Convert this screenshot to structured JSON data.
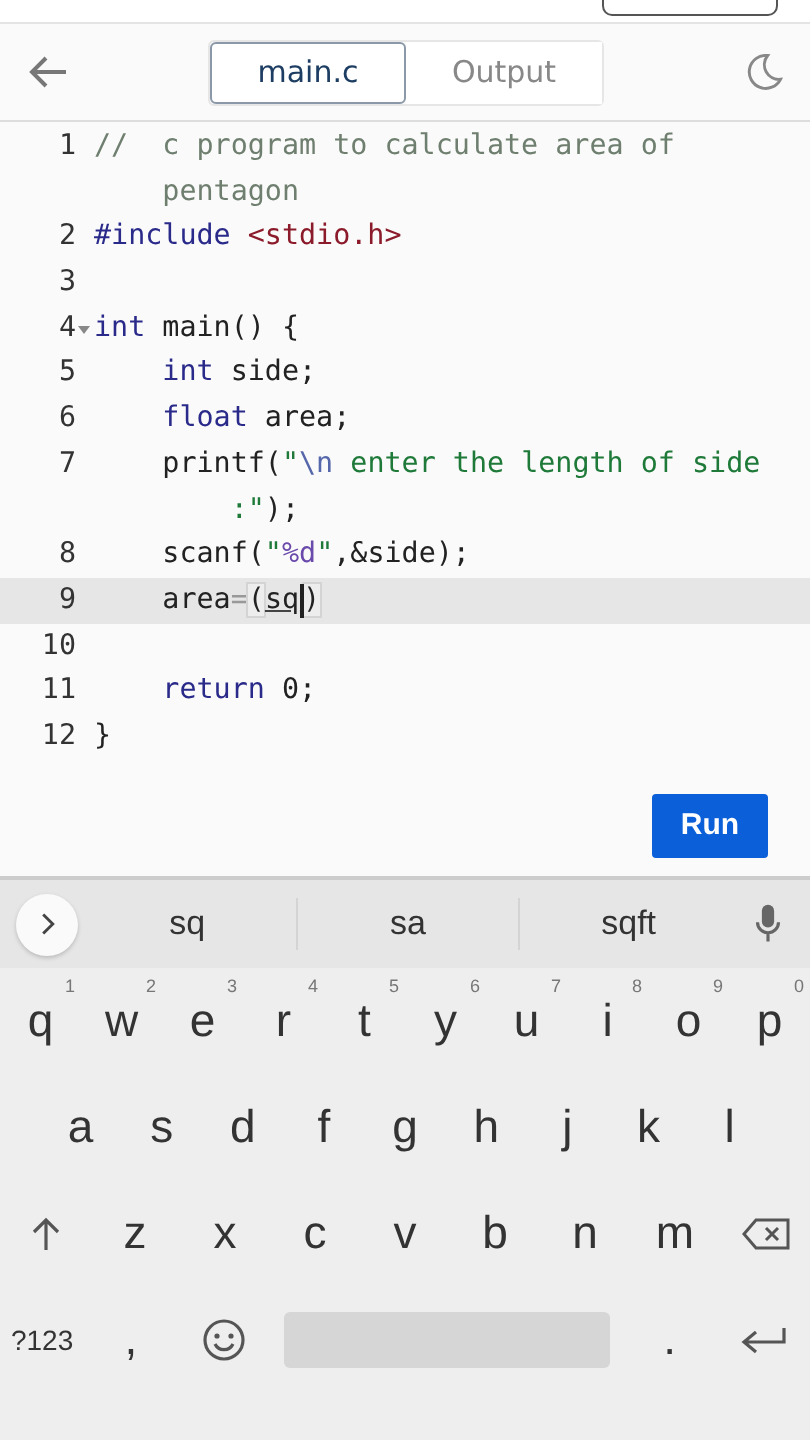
{
  "tabs": [
    {
      "label": "main.c",
      "selected": true
    },
    {
      "label": "Output",
      "selected": false
    }
  ],
  "editor": {
    "lines": [
      {
        "number": "1",
        "active": false,
        "foldable": false,
        "tokens": [
          {
            "kind": "comment",
            "text": "//  c program to calculate area of"
          }
        ],
        "wrap": [
          {
            "kind": "comment",
            "text": "    pentagon"
          }
        ]
      },
      {
        "number": "2",
        "active": false,
        "foldable": false,
        "tokens": [
          {
            "kind": "keyword",
            "text": "#include "
          },
          {
            "kind": "header",
            "text": "<stdio.h>"
          }
        ]
      },
      {
        "number": "3",
        "active": false,
        "foldable": false
      },
      {
        "number": "4",
        "active": false,
        "foldable": true,
        "tokens": [
          {
            "kind": "keyword",
            "text": "int"
          },
          {
            "kind": "plain",
            "text": " main() {"
          }
        ]
      },
      {
        "number": "5",
        "active": false,
        "foldable": false,
        "tokens": [
          {
            "kind": "keyword",
            "text": "    int"
          },
          {
            "kind": "plain",
            "text": " side;"
          }
        ]
      },
      {
        "number": "6",
        "active": false,
        "foldable": false,
        "tokens": [
          {
            "kind": "keyword",
            "text": "    float"
          },
          {
            "kind": "plain",
            "text": " area;"
          }
        ]
      },
      {
        "number": "7",
        "active": false,
        "foldable": false,
        "tokens": [
          {
            "kind": "plain",
            "text": "    printf("
          },
          {
            "kind": "string",
            "text": "\""
          },
          {
            "kind": "escape",
            "text": "\\n"
          },
          {
            "kind": "string",
            "text": " enter the length of side"
          }
        ],
        "wrap": [
          {
            "kind": "string",
            "text": "        :\""
          },
          {
            "kind": "plain",
            "text": ");"
          }
        ]
      },
      {
        "number": "8",
        "active": false,
        "foldable": false,
        "tokens": [
          {
            "kind": "plain",
            "text": "    scanf("
          },
          {
            "kind": "string",
            "text": "\""
          },
          {
            "kind": "format",
            "text": "%d"
          },
          {
            "kind": "string",
            "text": "\""
          },
          {
            "kind": "plain",
            "text": ",&side);"
          }
        ]
      },
      {
        "number": "9",
        "active": true,
        "foldable": false,
        "tokens": [
          {
            "kind": "plain",
            "text": "    area"
          },
          {
            "kind": "operator",
            "text": "="
          },
          {
            "kind": "bracket",
            "text": "("
          },
          {
            "kind": "composing",
            "text": "sq"
          },
          {
            "kind": "bracket",
            "text": ")"
          }
        ]
      },
      {
        "number": "10",
        "active": false,
        "foldable": false
      },
      {
        "number": "11",
        "active": false,
        "foldable": false,
        "tokens": [
          {
            "kind": "keyword",
            "text": "    return"
          },
          {
            "kind": "plain",
            "text": " 0;"
          }
        ]
      },
      {
        "number": "12",
        "active": false,
        "foldable": false,
        "tokens": [
          {
            "kind": "plain",
            "text": "}"
          }
        ]
      }
    ]
  },
  "run_button": "Run",
  "keyboard": {
    "suggestions": [
      "sq",
      "sa",
      "sqft"
    ],
    "rows": [
      [
        {
          "kind": "letter",
          "label": "q",
          "hint": "1"
        },
        {
          "kind": "letter",
          "label": "w",
          "hint": "2"
        },
        {
          "kind": "letter",
          "label": "e",
          "hint": "3"
        },
        {
          "kind": "letter",
          "label": "r",
          "hint": "4"
        },
        {
          "kind": "letter",
          "label": "t",
          "hint": "5"
        },
        {
          "kind": "letter",
          "label": "y",
          "hint": "6"
        },
        {
          "kind": "letter",
          "label": "u",
          "hint": "7"
        },
        {
          "kind": "letter",
          "label": "i",
          "hint": "8"
        },
        {
          "kind": "letter",
          "label": "o",
          "hint": "9"
        },
        {
          "kind": "letter",
          "label": "p",
          "hint": "0"
        }
      ],
      [
        {
          "kind": "letter",
          "label": "a"
        },
        {
          "kind": "letter",
          "label": "s"
        },
        {
          "kind": "letter",
          "label": "d"
        },
        {
          "kind": "letter",
          "label": "f"
        },
        {
          "kind": "letter",
          "label": "g"
        },
        {
          "kind": "letter",
          "label": "h"
        },
        {
          "kind": "letter",
          "label": "j"
        },
        {
          "kind": "letter",
          "label": "k"
        },
        {
          "kind": "letter",
          "label": "l"
        }
      ],
      [
        {
          "kind": "shift"
        },
        {
          "kind": "letter",
          "label": "z"
        },
        {
          "kind": "letter",
          "label": "x"
        },
        {
          "kind": "letter",
          "label": "c"
        },
        {
          "kind": "letter",
          "label": "v"
        },
        {
          "kind": "letter",
          "label": "b"
        },
        {
          "kind": "letter",
          "label": "n"
        },
        {
          "kind": "letter",
          "label": "m"
        },
        {
          "kind": "backspace"
        }
      ],
      [
        {
          "kind": "symbols",
          "label": "?123"
        },
        {
          "kind": "letter",
          "label": ","
        },
        {
          "kind": "emoji"
        },
        {
          "kind": "space"
        },
        {
          "kind": "letter",
          "label": "."
        },
        {
          "kind": "enter"
        }
      ]
    ]
  }
}
